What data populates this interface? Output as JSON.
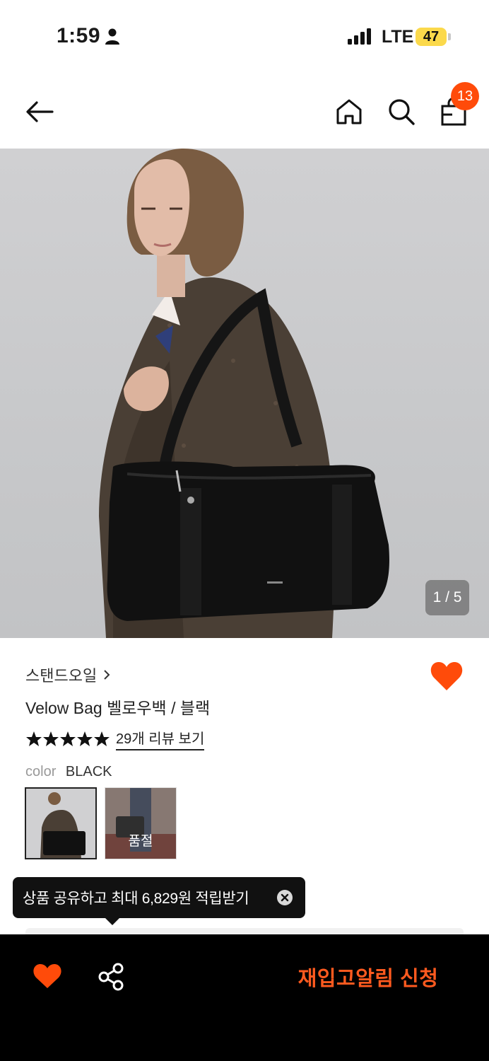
{
  "status_bar": {
    "time": "1:59",
    "network": "LTE",
    "battery": "47",
    "icons": [
      "person-icon",
      "signal-icon"
    ]
  },
  "top_nav": {
    "icons": [
      "back-arrow-icon",
      "home-icon",
      "search-icon",
      "shopping-bag-icon"
    ],
    "cart_count": "13"
  },
  "hero": {
    "image_counter": "1 / 5"
  },
  "product": {
    "brand": "스탠드오일",
    "name": "Velow Bag 벨로우백 / 블랙",
    "rating_stars": 5,
    "review_link": "29개 리뷰 보기",
    "color_label": "color",
    "color_value": "BLACK",
    "swatches": [
      {
        "state": "selected"
      },
      {
        "state": "sold-out",
        "label": "품절"
      }
    ]
  },
  "tooltip": {
    "text": "상품 공유하고 최대 6,829원 적립받기"
  },
  "bottom_bar": {
    "restock_label": "재입고알림 신청",
    "icons": [
      "heart-icon",
      "share-icon"
    ]
  },
  "colors": {
    "accent": "#ff4b0a",
    "restock_text": "#ff5a1f",
    "bottom_bar_bg": "#000000",
    "tooltip_bg": "#111111"
  }
}
